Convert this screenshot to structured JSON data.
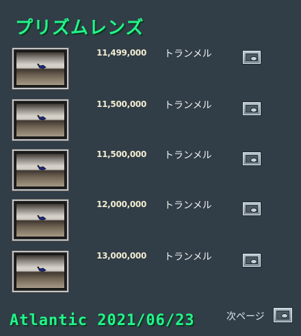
{
  "title": "プリズムレンズ",
  "listings": [
    {
      "price": "11,499,000",
      "seller": "トランメル",
      "item_icon": "prism-lens-thumbnail",
      "view_icon": "eye-icon"
    },
    {
      "price": "11,500,000",
      "seller": "トランメル",
      "item_icon": "prism-lens-thumbnail",
      "view_icon": "eye-icon"
    },
    {
      "price": "11,500,000",
      "seller": "トランメル",
      "item_icon": "prism-lens-thumbnail",
      "view_icon": "eye-icon"
    },
    {
      "price": "12,000,000",
      "seller": "トランメル",
      "item_icon": "prism-lens-thumbnail",
      "view_icon": "eye-icon"
    },
    {
      "price": "13,000,000",
      "seller": "トランメル",
      "item_icon": "prism-lens-thumbnail",
      "view_icon": "eye-icon"
    }
  ],
  "footer": {
    "label": "Atlantic 2021/06/23",
    "next_page": "次ページ"
  },
  "colors": {
    "background": "#313d47",
    "title": "#22f58a",
    "price": "#f1ecd2",
    "text": "#f3f3f3"
  }
}
